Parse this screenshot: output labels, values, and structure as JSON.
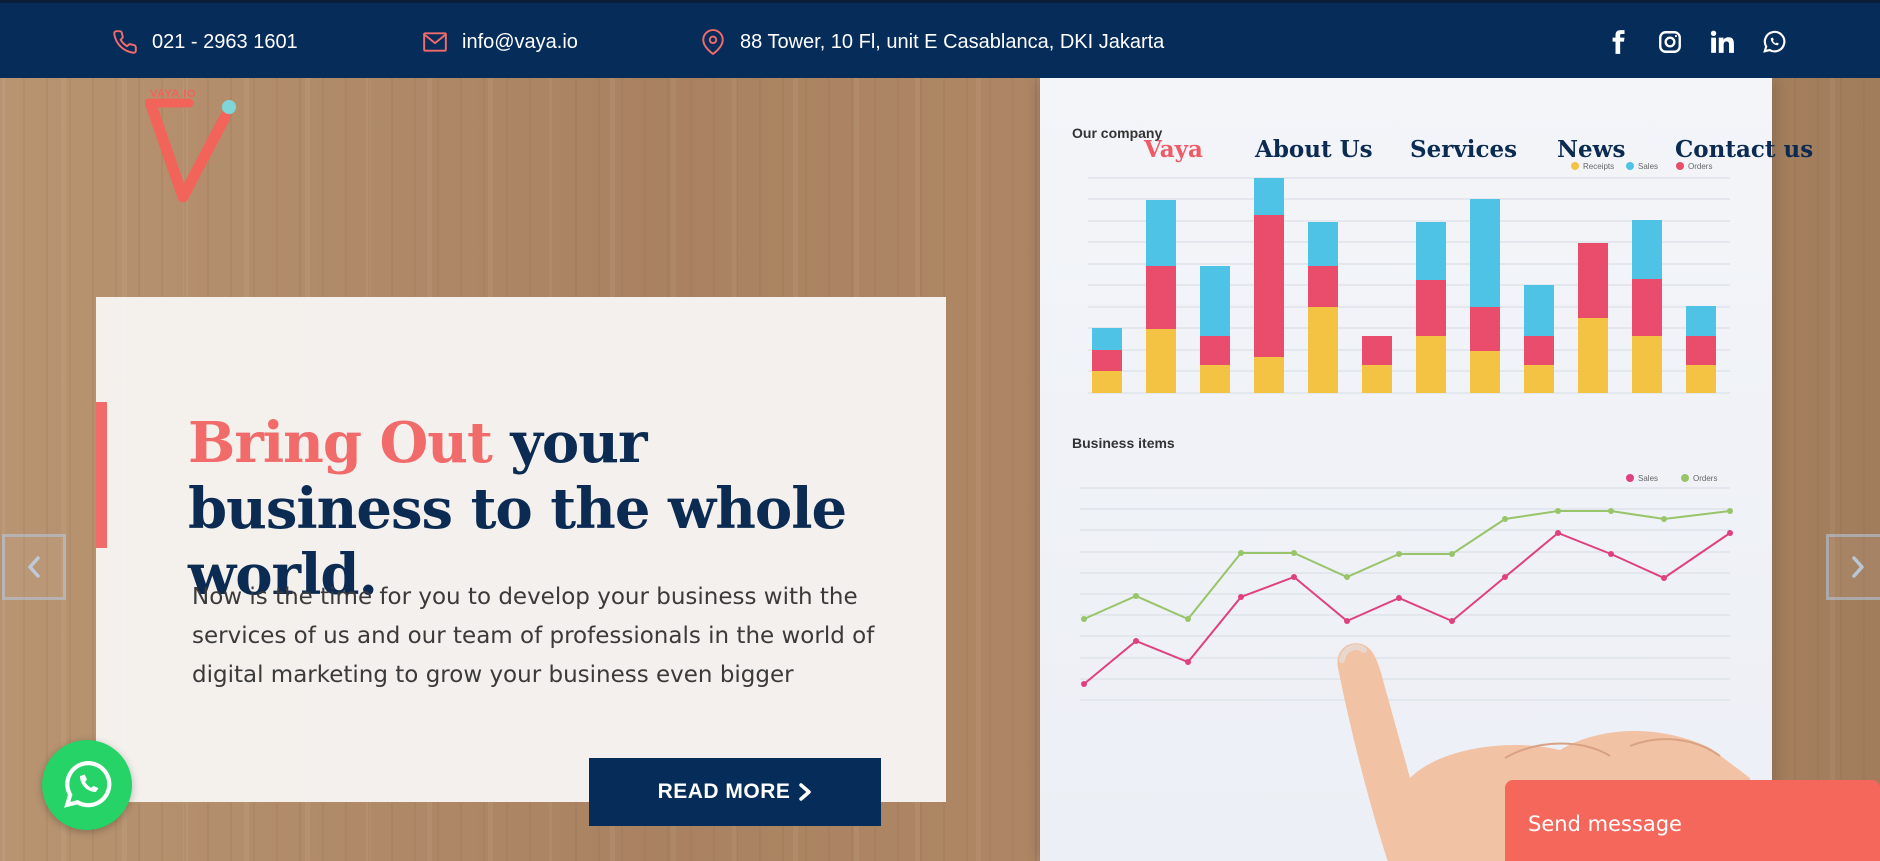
{
  "topbar": {
    "phone": "021 - 2963 1601",
    "email": "info@vaya.io",
    "address": "88 Tower, 10 Fl, unit E Casablanca, DKI Jakarta",
    "icons": [
      "phone-icon",
      "mail-icon",
      "location-pin-icon"
    ],
    "social_icons": [
      "facebook-icon",
      "instagram-icon",
      "linkedin-icon",
      "whatsapp-icon"
    ]
  },
  "logo": {
    "text": "VAYA.IO"
  },
  "nav": {
    "items": [
      {
        "label": "Vaya",
        "active": true
      },
      {
        "label": "About Us"
      },
      {
        "label": "Services"
      },
      {
        "label": "News"
      },
      {
        "label": "Contact us"
      }
    ]
  },
  "hero": {
    "headline_highlight": "Bring Out",
    "headline_rest": " your business to the whole world.",
    "description": "Now is the time for you to develop your business with the services of us and our team of professionals in the world of digital marketing to grow your business even bigger",
    "cta_label": "READ MORE"
  },
  "paper": {
    "chart1_title": "Our company",
    "chart2_title": "Business items"
  },
  "widgets": {
    "send_message": "Send message"
  },
  "colors": {
    "navy": "#062c5a",
    "accent": "#f26b6b",
    "whatsapp": "#25d366",
    "send_message": "#f6675b"
  }
}
